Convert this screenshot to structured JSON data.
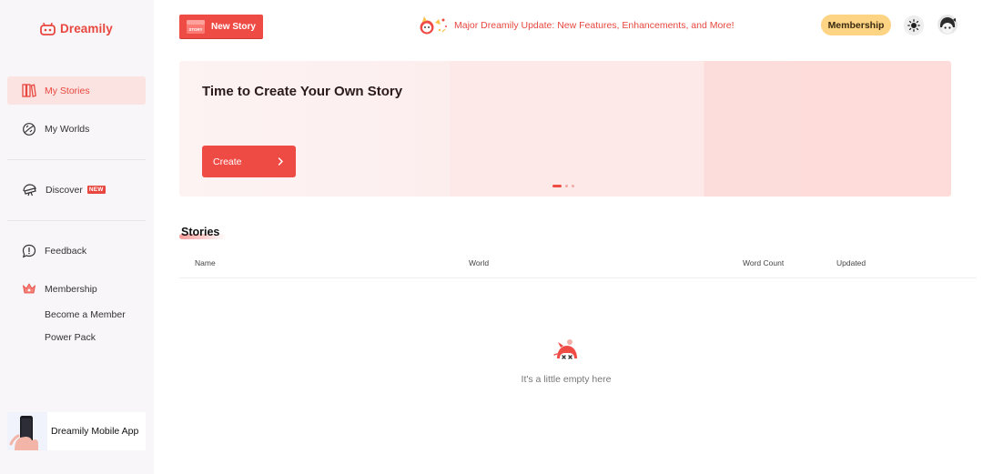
{
  "sidebar": {
    "logo": "Dreamily",
    "items": [
      {
        "label": "My Stories"
      },
      {
        "label": "My Worlds"
      },
      {
        "label": "Discover",
        "badge": "NEW"
      },
      {
        "label": "Feedback"
      },
      {
        "label": "Membership"
      }
    ],
    "membership_sub": [
      "Become a Member",
      "Power Pack"
    ],
    "mobile_app": "Dreamily Mobile App"
  },
  "header": {
    "new_story": "New Story",
    "new_story_badge": "STORY",
    "announcement": "Major Dreamily Update: New Features, Enhancements, and More!",
    "membership": "Membership"
  },
  "banner": {
    "title": "Time to Create Your Own Story",
    "create": "Create",
    "slide_count": 3,
    "active_slide": 1
  },
  "stories": {
    "title": "Stories",
    "columns": [
      "Name",
      "World",
      "Word Count",
      "Updated"
    ],
    "rows": [],
    "empty_text": "It's a little empty here"
  },
  "colors": {
    "accent": "#ef4b45",
    "membership": "#fcd483",
    "sidebar_bg": "#f8f6f8"
  },
  "icons": {
    "logo": "robot-face-icon",
    "my_stories": "books-icon",
    "my_worlds": "planet-icon",
    "discover": "telescope-icon",
    "feedback": "speech-bubble-icon",
    "membership": "crown-icon",
    "theme": "sun-icon"
  }
}
